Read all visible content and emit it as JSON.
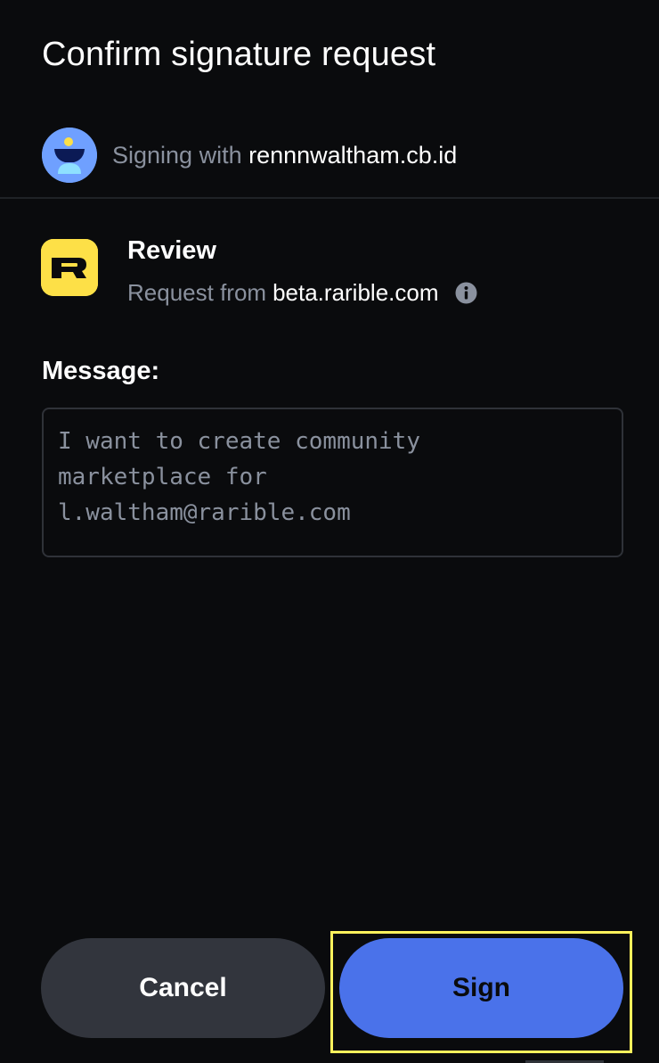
{
  "dialog": {
    "title": "Confirm signature request"
  },
  "signer": {
    "prefix": "Signing with",
    "name": "rennnwaltham.cb.id",
    "avatar_icon": "user-avatar-icon",
    "avatar_color": "#6fa0ff"
  },
  "review": {
    "title": "Review",
    "request_prefix": "Request from",
    "domain": "beta.rarible.com",
    "logo_icon": "rarible-logo-icon",
    "logo_color": "#fde047",
    "info_icon": "info-icon"
  },
  "message": {
    "label": "Message:",
    "text": "I want to create community\nmarketplace for\nl.waltham@rarible.com"
  },
  "actions": {
    "cancel_label": "Cancel",
    "sign_label": "Sign",
    "sign_color": "#4a72ea",
    "cancel_color": "#32353d"
  },
  "highlight_color": "#fff25c"
}
